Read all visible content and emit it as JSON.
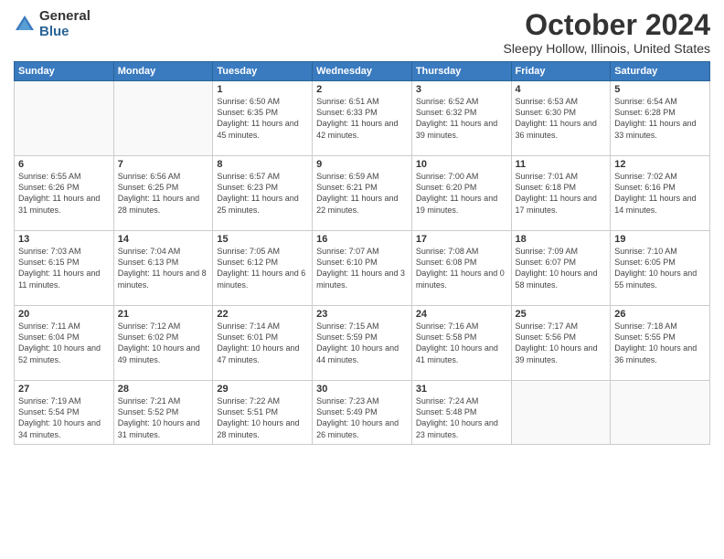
{
  "logo": {
    "general": "General",
    "blue": "Blue"
  },
  "header": {
    "month": "October 2024",
    "location": "Sleepy Hollow, Illinois, United States"
  },
  "weekdays": [
    "Sunday",
    "Monday",
    "Tuesday",
    "Wednesday",
    "Thursday",
    "Friday",
    "Saturday"
  ],
  "weeks": [
    [
      {
        "day": "",
        "sunrise": "",
        "sunset": "",
        "daylight": ""
      },
      {
        "day": "",
        "sunrise": "",
        "sunset": "",
        "daylight": ""
      },
      {
        "day": "1",
        "sunrise": "Sunrise: 6:50 AM",
        "sunset": "Sunset: 6:35 PM",
        "daylight": "Daylight: 11 hours and 45 minutes."
      },
      {
        "day": "2",
        "sunrise": "Sunrise: 6:51 AM",
        "sunset": "Sunset: 6:33 PM",
        "daylight": "Daylight: 11 hours and 42 minutes."
      },
      {
        "day": "3",
        "sunrise": "Sunrise: 6:52 AM",
        "sunset": "Sunset: 6:32 PM",
        "daylight": "Daylight: 11 hours and 39 minutes."
      },
      {
        "day": "4",
        "sunrise": "Sunrise: 6:53 AM",
        "sunset": "Sunset: 6:30 PM",
        "daylight": "Daylight: 11 hours and 36 minutes."
      },
      {
        "day": "5",
        "sunrise": "Sunrise: 6:54 AM",
        "sunset": "Sunset: 6:28 PM",
        "daylight": "Daylight: 11 hours and 33 minutes."
      }
    ],
    [
      {
        "day": "6",
        "sunrise": "Sunrise: 6:55 AM",
        "sunset": "Sunset: 6:26 PM",
        "daylight": "Daylight: 11 hours and 31 minutes."
      },
      {
        "day": "7",
        "sunrise": "Sunrise: 6:56 AM",
        "sunset": "Sunset: 6:25 PM",
        "daylight": "Daylight: 11 hours and 28 minutes."
      },
      {
        "day": "8",
        "sunrise": "Sunrise: 6:57 AM",
        "sunset": "Sunset: 6:23 PM",
        "daylight": "Daylight: 11 hours and 25 minutes."
      },
      {
        "day": "9",
        "sunrise": "Sunrise: 6:59 AM",
        "sunset": "Sunset: 6:21 PM",
        "daylight": "Daylight: 11 hours and 22 minutes."
      },
      {
        "day": "10",
        "sunrise": "Sunrise: 7:00 AM",
        "sunset": "Sunset: 6:20 PM",
        "daylight": "Daylight: 11 hours and 19 minutes."
      },
      {
        "day": "11",
        "sunrise": "Sunrise: 7:01 AM",
        "sunset": "Sunset: 6:18 PM",
        "daylight": "Daylight: 11 hours and 17 minutes."
      },
      {
        "day": "12",
        "sunrise": "Sunrise: 7:02 AM",
        "sunset": "Sunset: 6:16 PM",
        "daylight": "Daylight: 11 hours and 14 minutes."
      }
    ],
    [
      {
        "day": "13",
        "sunrise": "Sunrise: 7:03 AM",
        "sunset": "Sunset: 6:15 PM",
        "daylight": "Daylight: 11 hours and 11 minutes."
      },
      {
        "day": "14",
        "sunrise": "Sunrise: 7:04 AM",
        "sunset": "Sunset: 6:13 PM",
        "daylight": "Daylight: 11 hours and 8 minutes."
      },
      {
        "day": "15",
        "sunrise": "Sunrise: 7:05 AM",
        "sunset": "Sunset: 6:12 PM",
        "daylight": "Daylight: 11 hours and 6 minutes."
      },
      {
        "day": "16",
        "sunrise": "Sunrise: 7:07 AM",
        "sunset": "Sunset: 6:10 PM",
        "daylight": "Daylight: 11 hours and 3 minutes."
      },
      {
        "day": "17",
        "sunrise": "Sunrise: 7:08 AM",
        "sunset": "Sunset: 6:08 PM",
        "daylight": "Daylight: 11 hours and 0 minutes."
      },
      {
        "day": "18",
        "sunrise": "Sunrise: 7:09 AM",
        "sunset": "Sunset: 6:07 PM",
        "daylight": "Daylight: 10 hours and 58 minutes."
      },
      {
        "day": "19",
        "sunrise": "Sunrise: 7:10 AM",
        "sunset": "Sunset: 6:05 PM",
        "daylight": "Daylight: 10 hours and 55 minutes."
      }
    ],
    [
      {
        "day": "20",
        "sunrise": "Sunrise: 7:11 AM",
        "sunset": "Sunset: 6:04 PM",
        "daylight": "Daylight: 10 hours and 52 minutes."
      },
      {
        "day": "21",
        "sunrise": "Sunrise: 7:12 AM",
        "sunset": "Sunset: 6:02 PM",
        "daylight": "Daylight: 10 hours and 49 minutes."
      },
      {
        "day": "22",
        "sunrise": "Sunrise: 7:14 AM",
        "sunset": "Sunset: 6:01 PM",
        "daylight": "Daylight: 10 hours and 47 minutes."
      },
      {
        "day": "23",
        "sunrise": "Sunrise: 7:15 AM",
        "sunset": "Sunset: 5:59 PM",
        "daylight": "Daylight: 10 hours and 44 minutes."
      },
      {
        "day": "24",
        "sunrise": "Sunrise: 7:16 AM",
        "sunset": "Sunset: 5:58 PM",
        "daylight": "Daylight: 10 hours and 41 minutes."
      },
      {
        "day": "25",
        "sunrise": "Sunrise: 7:17 AM",
        "sunset": "Sunset: 5:56 PM",
        "daylight": "Daylight: 10 hours and 39 minutes."
      },
      {
        "day": "26",
        "sunrise": "Sunrise: 7:18 AM",
        "sunset": "Sunset: 5:55 PM",
        "daylight": "Daylight: 10 hours and 36 minutes."
      }
    ],
    [
      {
        "day": "27",
        "sunrise": "Sunrise: 7:19 AM",
        "sunset": "Sunset: 5:54 PM",
        "daylight": "Daylight: 10 hours and 34 minutes."
      },
      {
        "day": "28",
        "sunrise": "Sunrise: 7:21 AM",
        "sunset": "Sunset: 5:52 PM",
        "daylight": "Daylight: 10 hours and 31 minutes."
      },
      {
        "day": "29",
        "sunrise": "Sunrise: 7:22 AM",
        "sunset": "Sunset: 5:51 PM",
        "daylight": "Daylight: 10 hours and 28 minutes."
      },
      {
        "day": "30",
        "sunrise": "Sunrise: 7:23 AM",
        "sunset": "Sunset: 5:49 PM",
        "daylight": "Daylight: 10 hours and 26 minutes."
      },
      {
        "day": "31",
        "sunrise": "Sunrise: 7:24 AM",
        "sunset": "Sunset: 5:48 PM",
        "daylight": "Daylight: 10 hours and 23 minutes."
      },
      {
        "day": "",
        "sunrise": "",
        "sunset": "",
        "daylight": ""
      },
      {
        "day": "",
        "sunrise": "",
        "sunset": "",
        "daylight": ""
      }
    ]
  ]
}
